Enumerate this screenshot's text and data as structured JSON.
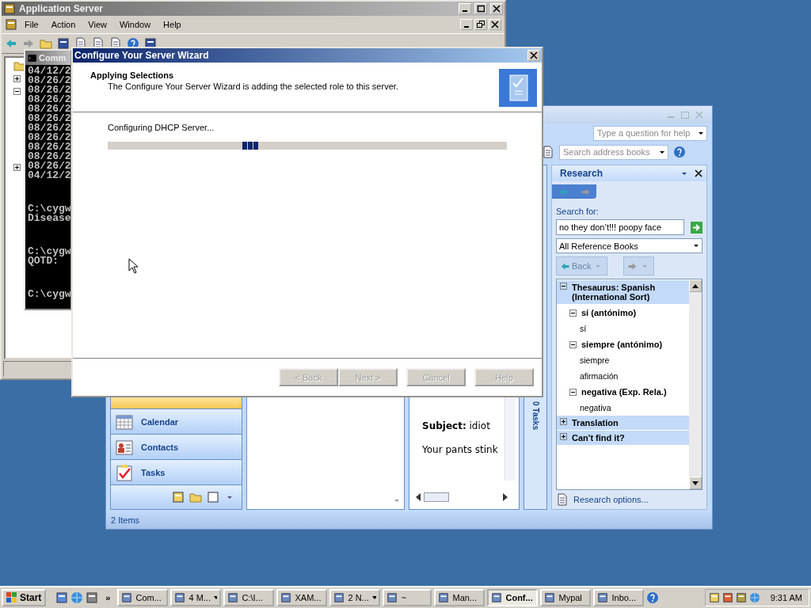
{
  "app_server": {
    "title": "Application Server",
    "menu": [
      "File",
      "Action",
      "View",
      "Window",
      "Help"
    ],
    "tree": [
      {
        "expanded": false
      },
      {
        "expanded": true
      },
      {
        "expanded": false
      }
    ]
  },
  "console": {
    "title": "Comm",
    "blocks": [
      [
        "04/12/2",
        "08/26/2",
        "08/26/2",
        "08/26/2",
        "08/26/2",
        "08/26/2",
        "08/26/2",
        "08/26/2",
        "08/26/2",
        "08/26/2",
        "08/26/2",
        "04/12/2"
      ],
      [
        "C:\\cygw",
        "Disease"
      ],
      [
        "C:\\cygw",
        "QOTD:"
      ],
      [
        "C:\\cygw"
      ]
    ]
  },
  "outlook": {
    "help_placeholder": "Type a question for help",
    "address_placeholder": "Search address books",
    "nav_items": [
      {
        "selected": true
      },
      {
        "label": "Calendar",
        "selected": false,
        "kind": "calendar"
      },
      {
        "label": "Contacts",
        "selected": false,
        "kind": "contacts"
      },
      {
        "label": "Tasks",
        "selected": false,
        "kind": "tasks"
      }
    ],
    "reading_pane": {
      "subject": "**Subject:** idiot",
      "body": "Your pants stink"
    },
    "todo_bar": "0 Tasks",
    "status": "2 Items",
    "research": {
      "title": "Research",
      "search_label": "Search for:",
      "search_value": "no they don’t!!! poopy face",
      "source": "All Reference Books",
      "back_label": "Back",
      "back_disabled": true,
      "results": [
        {
          "label": "Thesaurus: Spanish (International Sort)",
          "expanded": true,
          "children": [
            {
              "label": "sí (antónimo)",
              "expanded": true,
              "children": [
                {
                  "label": "sí"
                }
              ]
            },
            {
              "label": "siempre (antónimo)",
              "expanded": true,
              "children": [
                {
                  "label": "siempre"
                },
                {
                  "label": "afirmación"
                }
              ]
            },
            {
              "label": "negativa (Exp. Rela.)",
              "expanded": true,
              "children": [
                {
                  "label": "negativa"
                }
              ]
            }
          ]
        },
        {
          "label": "Translation",
          "expanded": false
        },
        {
          "label": "Can't find it?",
          "expanded": false
        }
      ],
      "options_link": "Research options..."
    }
  },
  "wizard": {
    "title": "Configure Your Server Wizard",
    "heading": "Applying Selections",
    "subtitle": "The Configure Your Server Wizard is adding the selected role to this server.",
    "status": "Configuring DHCP Server...",
    "buttons": [
      {
        "label": "< Back",
        "disabled": true
      },
      {
        "label": "Next >",
        "disabled": true
      },
      {
        "label": "Cancel",
        "disabled": true
      },
      {
        "label": "Help",
        "disabled": true
      }
    ]
  },
  "taskbar": {
    "start": "Start",
    "more": "»",
    "buttons": [
      {
        "label": "Com...",
        "selected": false
      },
      {
        "label": "4 M...",
        "selected": false,
        "grouped": true
      },
      {
        "label": "C:\\I...",
        "selected": false
      },
      {
        "label": "XAM...",
        "selected": false
      },
      {
        "label": "2 N...",
        "selected": false,
        "grouped": true
      },
      {
        "label": "~",
        "selected": false
      },
      {
        "label": "Man...",
        "selected": false
      },
      {
        "label": "Conf...",
        "selected": true
      },
      {
        "label": "Mypal",
        "selected": false
      },
      {
        "label": "Inbo...",
        "selected": false
      }
    ],
    "clock": "9:31 AM"
  }
}
